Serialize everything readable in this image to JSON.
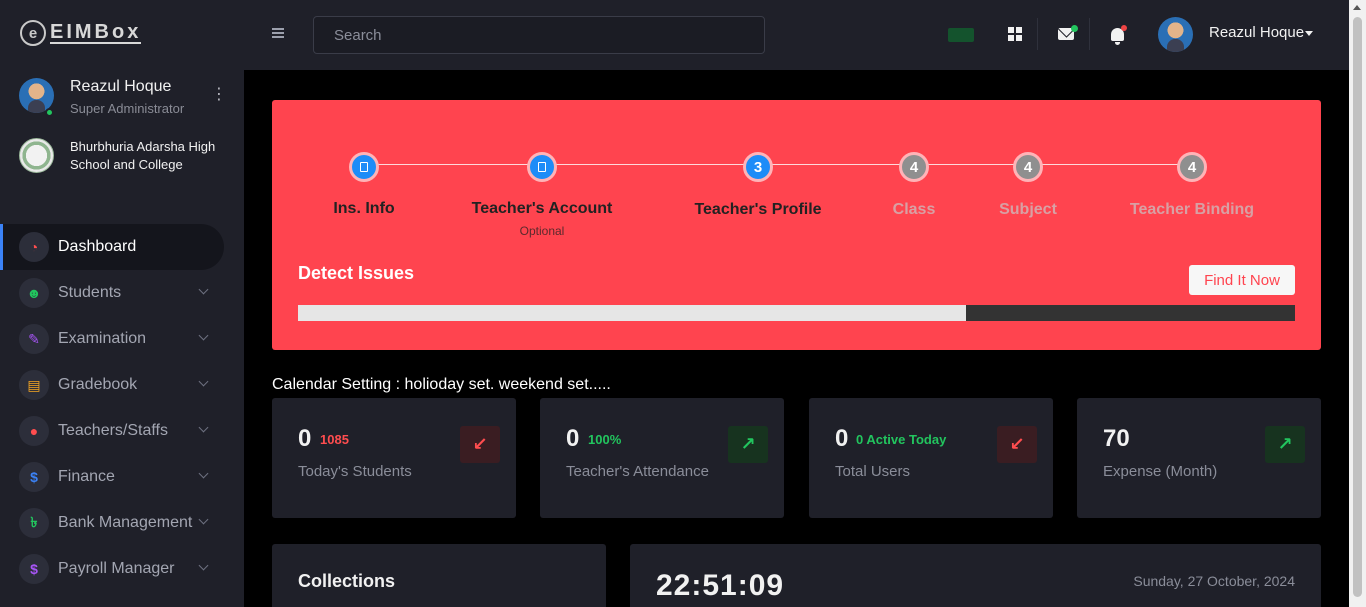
{
  "app": {
    "logo_mark": "e",
    "logo_text": "EIMBox"
  },
  "profile": {
    "name": "Reazul Hoque",
    "role": "Super Administrator",
    "kebab": "⋮"
  },
  "school": {
    "name": "Bhurbhuria Adarsha High School and College"
  },
  "nav": [
    {
      "label": "Dashboard",
      "icon": "dashboard-gauge-icon",
      "glyph": "◔",
      "color": "#ff4d4f"
    },
    {
      "label": "Students",
      "icon": "students-icon",
      "glyph": "☻",
      "color": "#22c55e"
    },
    {
      "label": "Examination",
      "icon": "pen-icon",
      "glyph": "✎",
      "color": "#a855f7"
    },
    {
      "label": "Gradebook",
      "icon": "document-icon",
      "glyph": "▤",
      "color": "#f5a623"
    },
    {
      "label": "Teachers/Staffs",
      "icon": "user-icon",
      "glyph": "●",
      "color": "#ff4d4f"
    },
    {
      "label": "Finance",
      "icon": "dollar-icon",
      "glyph": "$",
      "color": "#3b82f6"
    },
    {
      "label": "Bank Management",
      "icon": "taka-icon",
      "glyph": "৳",
      "color": "#22c55e"
    },
    {
      "label": "Payroll Manager",
      "icon": "dollar-circle-icon",
      "glyph": "$",
      "color": "#a855f7"
    }
  ],
  "search": {
    "placeholder": "Search"
  },
  "topbar": {
    "user_name": "Reazul Hoque"
  },
  "setup": {
    "steps": [
      {
        "label": "Ins. Info",
        "number": "",
        "state": "done"
      },
      {
        "label": "Teacher's Account",
        "sub": "Optional",
        "number": "",
        "state": "done"
      },
      {
        "label": "Teacher's Profile",
        "number": "3",
        "state": "current"
      },
      {
        "label": "Class",
        "number": "4",
        "state": "todo"
      },
      {
        "label": "Subject",
        "number": "4",
        "state": "todo"
      },
      {
        "label": "Teacher Binding",
        "number": "4",
        "state": "todo"
      }
    ],
    "detect_title": "Detect Issues",
    "find_button": "Find It Now",
    "progress_fraction": 0.67
  },
  "calendar_setting": "Calendar Setting : holioday set. weekend set.....",
  "cards": [
    {
      "value": "0",
      "meta": "1085",
      "meta_color": "red",
      "label": "Today's Students",
      "trend": "down",
      "glyph": "↙"
    },
    {
      "value": "0",
      "meta": "100%",
      "meta_color": "green",
      "label": "Teacher's Attendance",
      "trend": "up",
      "glyph": "↗"
    },
    {
      "value": "0",
      "meta": "0 Active Today",
      "meta_color": "green",
      "label": "Total Users",
      "trend": "down",
      "glyph": "↙"
    },
    {
      "value": "70",
      "meta": "",
      "meta_color": "green",
      "label": "Expense (Month)",
      "trend": "up",
      "glyph": "↗"
    }
  ],
  "collections": {
    "title": "Collections"
  },
  "clock": {
    "time": "22:51:09",
    "date": "Sunday, 27 October, 2024"
  }
}
